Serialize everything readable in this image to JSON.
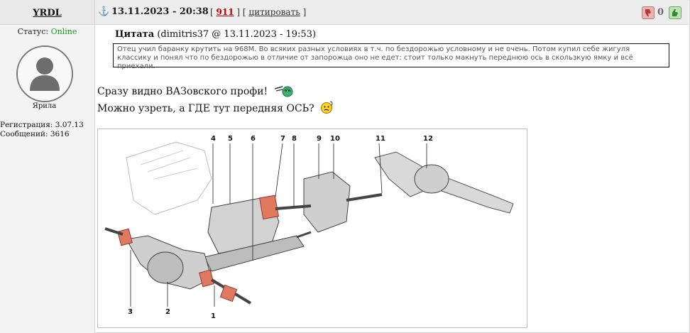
{
  "user": {
    "nickname": "YRDL",
    "status_label": "Статус:",
    "status_value": "Online",
    "rank": "Ярила",
    "registration": "Регистрация: 3.07.13",
    "messages": "Сообщений: 3616"
  },
  "post": {
    "datetime": "13.11.2023 - 20:38",
    "id_link": "911",
    "bracket_open": "[",
    "bracket_mid": "] [",
    "quote_link": "цитировать",
    "bracket_close": "]",
    "vote_count": "0"
  },
  "quote": {
    "title": "Цитата",
    "author_info": "(dimitris37 @ 13.11.2023 - 19:53)",
    "text": "Отец учил баранку крутить на 968М. Во всяких разных условиях в т.ч. по бездорожью условному и не очень. Потом купил себе жигуля классику и понял что по бездорожью в отличие от запорожца оно не едет: стоит только макнуть переднюю ось в скользкую ямку и всё приехали."
  },
  "message": {
    "line1": "Сразу видно ВАЗовского профи!",
    "line2": "Можно узреть, а ГДЕ тут передняя ОСЬ?"
  },
  "diagram": {
    "labels": [
      "1",
      "2",
      "3",
      "4",
      "5",
      "6",
      "7",
      "8",
      "9",
      "10",
      "11",
      "12"
    ]
  },
  "colors": {
    "online": "#1f9a1f",
    "post_link": "#c00000",
    "sidebar_bg": "#f3f3f3",
    "header_bg": "#ededed"
  },
  "icons": {
    "anchor": "anchor-icon",
    "vote_down": "thumb-down-icon",
    "vote_up": "thumb-up-icon"
  }
}
